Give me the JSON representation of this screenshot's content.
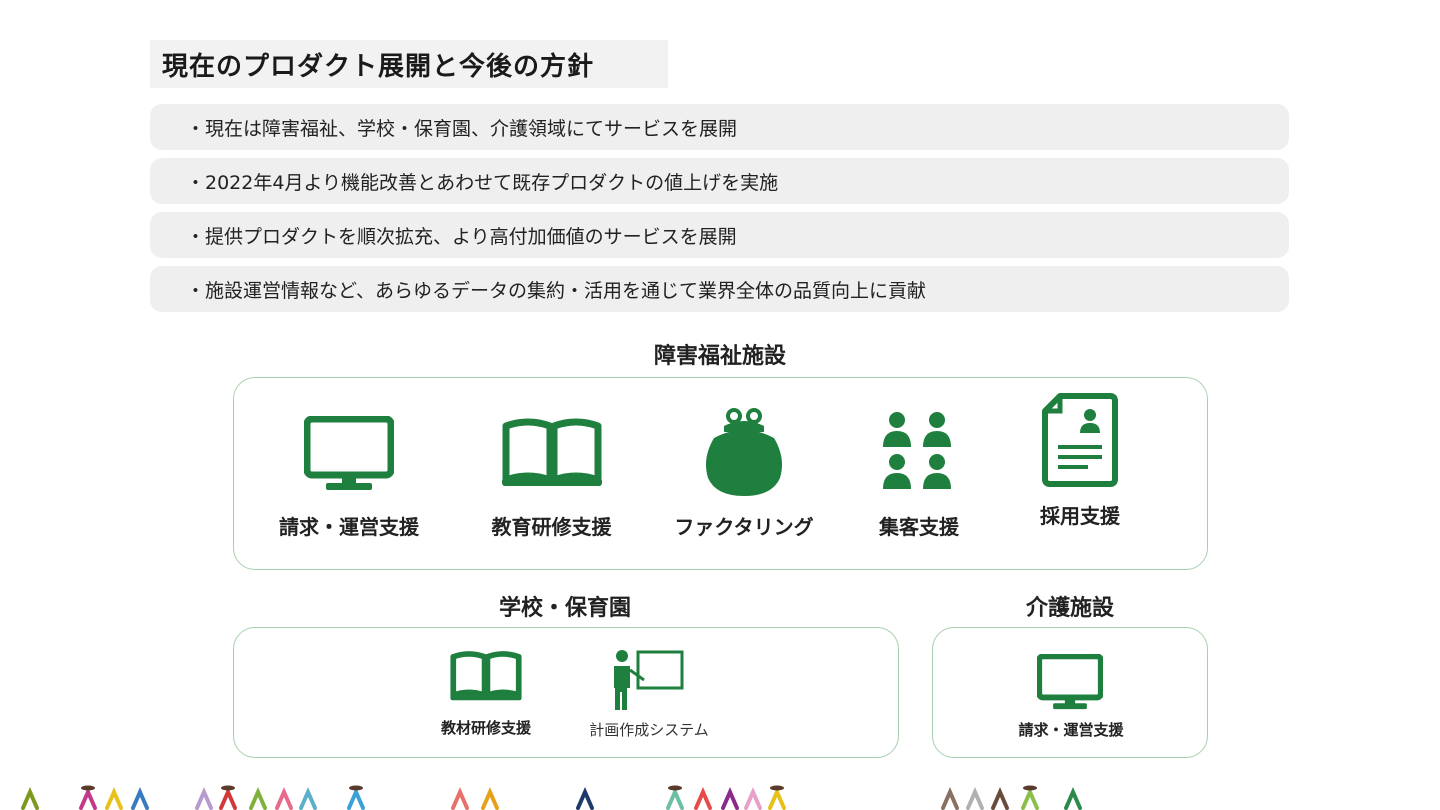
{
  "page_title": "現在のプロダクト展開と今後の方針",
  "bullets": [
    "・現在は障害福祉、学校・保育園、介護領域にてサービスを展開",
    "・2022年4月より機能改善とあわせて既存プロダクトの値上げを実施",
    "・提供プロダクトを順次拡充、より高付加価値のサービスを展開",
    "・施設運営情報など、あらゆるデータの集約・活用を通じて業界全体の品質向上に貢献"
  ],
  "sections": {
    "welfare": {
      "title": "障害福祉施設",
      "items": [
        {
          "label": "請求・運営支援",
          "icon": "monitor-icon"
        },
        {
          "label": "教育研修支援",
          "icon": "book-icon"
        },
        {
          "label": "ファクタリング",
          "icon": "purse-icon"
        },
        {
          "label": "集客支援",
          "icon": "people-group-icon"
        },
        {
          "label": "採用支援",
          "icon": "resume-icon"
        }
      ]
    },
    "school": {
      "title": "学校・保育園",
      "items": [
        {
          "label": "教材研修支援",
          "icon": "book-icon"
        },
        {
          "label": "計画作成システム",
          "icon": "teacher-board-icon"
        }
      ]
    },
    "care": {
      "title": "介護施設",
      "items": [
        {
          "label": "請求・運営支援",
          "icon": "monitor-icon"
        }
      ]
    }
  },
  "colors": {
    "icon_green": "#1e7f3e",
    "panel_border": "#a8d0ae",
    "bullet_bg": "#efefef"
  },
  "footer_people_colors": [
    "#7a9a1e",
    "#c2388a",
    "#e8c11a",
    "#3a7abf",
    "#b79ad0",
    "#d23a3a",
    "#7fb23a",
    "#e86a8a",
    "#5ab0c8",
    "#3aa0d8",
    "#e8706a",
    "#e8a01a",
    "#1e3a6a",
    "#6ac0a0",
    "#e84a4a",
    "#8a2a8a",
    "#e8a0c8",
    "#e8c01a",
    "#8a7060",
    "#b0b0b0",
    "#6a4a3a",
    "#8ac04a",
    "#2a8a4a"
  ]
}
